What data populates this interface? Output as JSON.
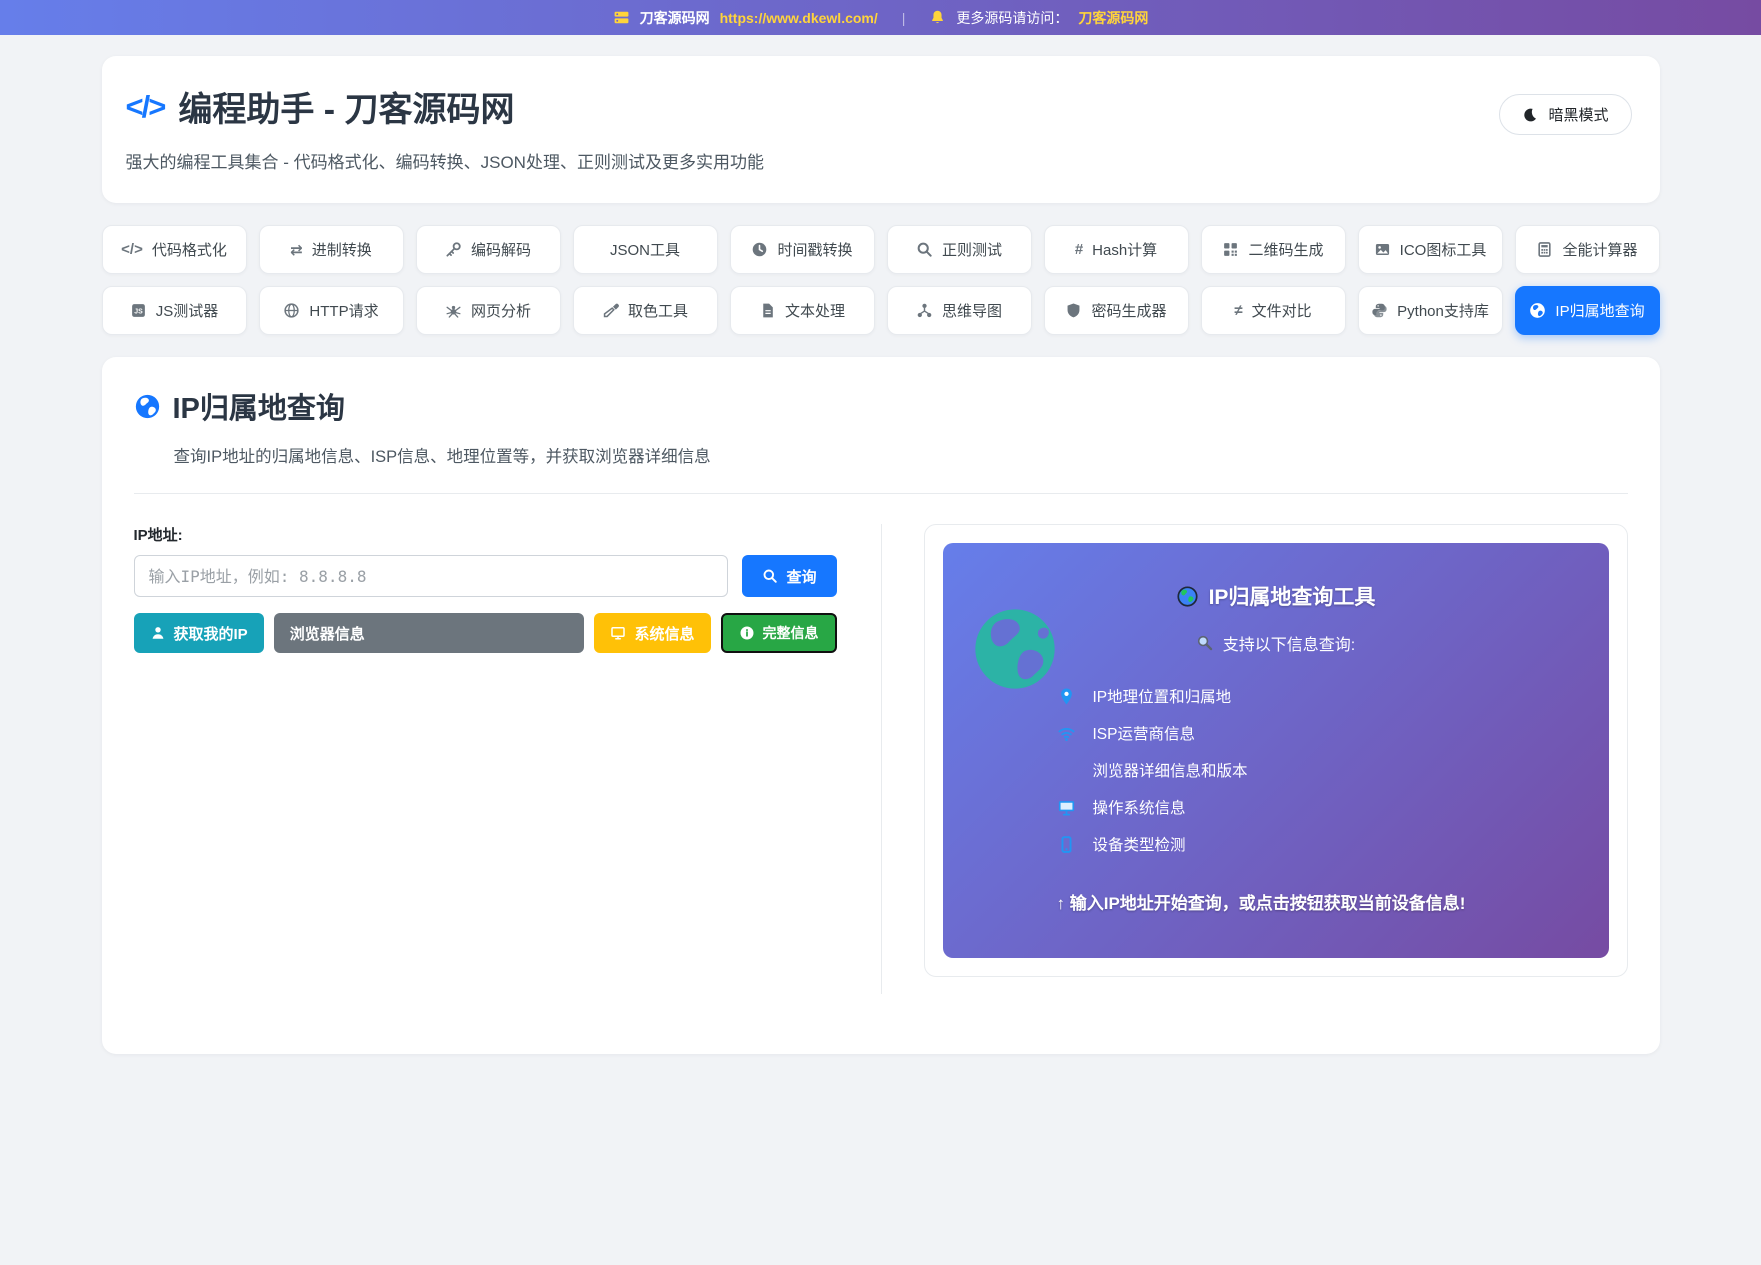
{
  "topbar": {
    "site_name": "刀客源码网",
    "site_url": "https://www.dkewl.com/",
    "divider": "|",
    "notice_label": "更多源码请访问：",
    "notice_link": "刀客源码网"
  },
  "header": {
    "title": "编程助手 - 刀客源码网",
    "code_glyph": "</>",
    "subtitle": "强大的编程工具集合 - 代码格式化、编码转换、JSON处理、正则测试及更多实用功能",
    "dark_mode_label": "暗黑模式"
  },
  "tabs": [
    {
      "id": "code-format",
      "icon": "code",
      "label": "代码格式化",
      "active": false
    },
    {
      "id": "base-convert",
      "icon": "swap",
      "label": "进制转换",
      "active": false
    },
    {
      "id": "encode-decode",
      "icon": "key",
      "label": "编码解码",
      "active": false
    },
    {
      "id": "json-tools",
      "icon": "",
      "label": "JSON工具",
      "active": false
    },
    {
      "id": "timestamp",
      "icon": "clock",
      "label": "时间戳转换",
      "active": false
    },
    {
      "id": "regex-test",
      "icon": "search",
      "label": "正则测试",
      "active": false
    },
    {
      "id": "hash-calc",
      "icon": "hash",
      "label": "Hash计算",
      "active": false
    },
    {
      "id": "qrcode-gen",
      "icon": "qr",
      "label": "二维码生成",
      "active": false
    },
    {
      "id": "ico-tools",
      "icon": "image",
      "label": "ICO图标工具",
      "active": false
    },
    {
      "id": "calculator",
      "icon": "calculator",
      "label": "全能计算器",
      "active": false
    },
    {
      "id": "js-tester",
      "icon": "js",
      "label": "JS测试器",
      "active": false
    },
    {
      "id": "http-request",
      "icon": "globe-wire",
      "label": "HTTP请求",
      "active": false
    },
    {
      "id": "web-analysis",
      "icon": "spider",
      "label": "网页分析",
      "active": false
    },
    {
      "id": "color-picker",
      "icon": "eyedropper",
      "label": "取色工具",
      "active": false
    },
    {
      "id": "text-process",
      "icon": "file",
      "label": "文本处理",
      "active": false
    },
    {
      "id": "mindmap",
      "icon": "mindmap",
      "label": "思维导图",
      "active": false
    },
    {
      "id": "password-gen",
      "icon": "shield",
      "label": "密码生成器",
      "active": false
    },
    {
      "id": "file-diff",
      "icon": "neq",
      "label": "文件对比",
      "active": false
    },
    {
      "id": "python-lib",
      "icon": "python",
      "label": "Python支持库",
      "active": false
    },
    {
      "id": "ip-lookup",
      "icon": "globe",
      "label": "IP归属地查询",
      "active": true
    }
  ],
  "tool": {
    "title": "IP归属地查询",
    "subtitle": "查询IP地址的归属地信息、ISP信息、地理位置等，并获取浏览器详细信息",
    "ip_label": "IP地址:",
    "ip_placeholder": "输入IP地址，例如: 8.8.8.8",
    "query_button": "查询",
    "buttons": {
      "my_ip": "获取我的IP",
      "browser": "浏览器信息",
      "system": "系统信息",
      "full": "完整信息"
    }
  },
  "panel": {
    "title": "IP归属地查询工具",
    "subtitle": "支持以下信息查询:",
    "features": [
      {
        "icon": "pin",
        "text": "IP地理位置和归属地"
      },
      {
        "icon": "wifi",
        "text": "ISP运营商信息"
      },
      {
        "icon": "",
        "text": "浏览器详细信息和版本"
      },
      {
        "icon": "monitor",
        "text": "操作系统信息"
      },
      {
        "icon": "phone",
        "text": "设备类型检测"
      }
    ],
    "footer": "↑ 输入IP地址开始查询，或点击按钮获取当前设备信息!"
  },
  "colors": {
    "accent_blue": "#1677ff",
    "gradient_start": "#667eea",
    "gradient_end": "#764ba2",
    "link_yellow": "#ffd43b",
    "teal": "#17a2b8",
    "gray": "#6c757d",
    "amber": "#ffc107",
    "green": "#28a745",
    "feature_icon_blue": "#2196f3",
    "globe_teal": "#2cb3a6"
  }
}
